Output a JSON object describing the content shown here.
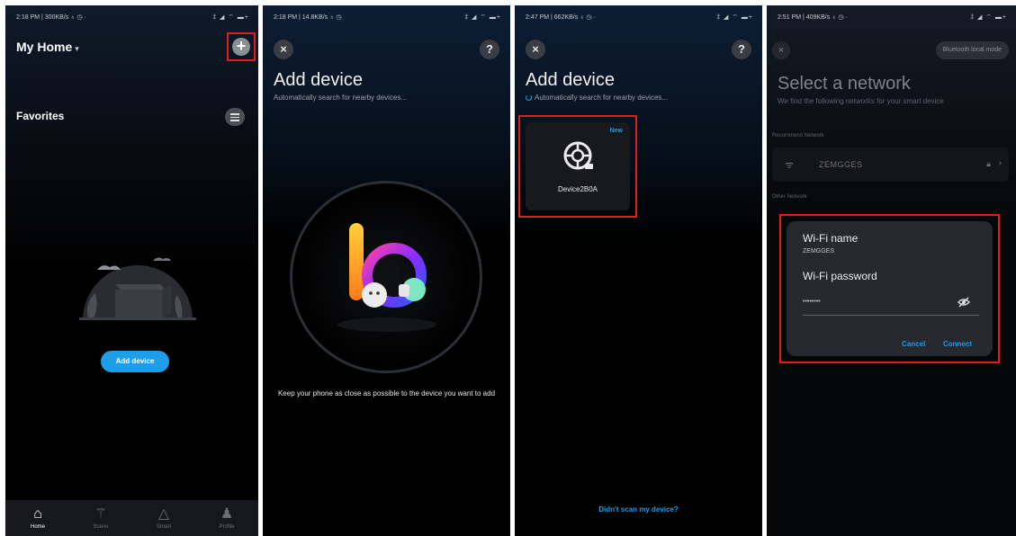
{
  "screen1": {
    "status_time": "2:18 PM | 300KB/s ♁ ◷ ·",
    "status_icons": "‡ ◢ ⌔ ▬+",
    "home_title": "My Home",
    "add_icon": "plus-icon",
    "favorites_label": "Favorites",
    "add_device_button": "Add device",
    "nav": [
      {
        "label": "Home",
        "icon": "home-icon",
        "active": true
      },
      {
        "label": "Scene",
        "icon": "wand-icon",
        "active": false
      },
      {
        "label": "Smart",
        "icon": "smart-icon",
        "active": false
      },
      {
        "label": "Profile",
        "icon": "profile-icon",
        "active": false
      }
    ]
  },
  "screen2": {
    "status_time": "2:18 PM | 14.8KB/s ♁ ◷",
    "status_icons": "‡ ◢ ⌔ ▬+",
    "title": "Add device",
    "subtitle": "Automatically search for nearby devices...",
    "hint": "Keep your phone as close as possible to the device you want to add"
  },
  "screen3": {
    "status_time": "2:47 PM | 662KB/s ♁ ◷ ·",
    "status_icons": "‡ ◢ ⌔ ▬+",
    "title": "Add device",
    "subtitle": "Automatically search for nearby devices...",
    "device_badge": "New",
    "device_name": "Device2B0A",
    "didnt_scan_link": "Didn't scan my device?"
  },
  "screen4": {
    "status_time": "2:51 PM | 409KB/s ♁ ◷ ·",
    "status_icons": "‡ ◢ ⌔ ▬+",
    "bt_mode_button": "Bluetooth local mode",
    "title": "Select a network",
    "subtitle": "We find the following networks for your smart device",
    "recommended_label": "Recommend Network",
    "network_ssid": "ZEMGGES",
    "other_label": "Other Network",
    "dialog": {
      "wifi_name_label": "Wi-Fi name",
      "wifi_name_value": "ZEMGGES",
      "wifi_password_label": "Wi-Fi password",
      "wifi_password_value": "••••••••",
      "cancel_button": "Cancel",
      "connect_button": "Connect"
    }
  },
  "common": {
    "close_glyph": "×",
    "help_glyph": "?"
  },
  "colors": {
    "accent": "#1e9de8",
    "highlight": "#e01e1e",
    "background": "#000000"
  }
}
